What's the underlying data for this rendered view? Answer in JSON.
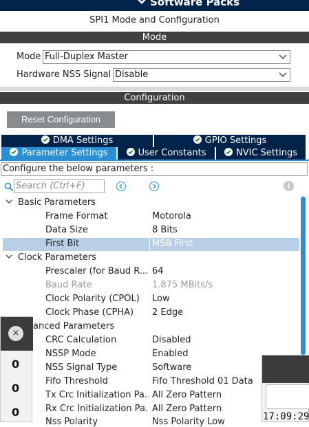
{
  "header": {
    "title": "Software Packs",
    "subtitle": "SPI1 Mode and Configuration"
  },
  "mode_section": {
    "title": "Mode",
    "mode_label": "Mode",
    "mode_value": "Full-Duplex Master",
    "nss_label": "Hardware NSS Signal",
    "nss_value": "Disable"
  },
  "config_section": {
    "title": "Configuration",
    "reset_button": "Reset Configuration"
  },
  "tabs": {
    "row1": [
      "DMA Settings",
      "GPIO Settings"
    ],
    "row2": [
      "Parameter Settings",
      "User Constants",
      "NVIC Settings"
    ],
    "active": "Parameter Settings"
  },
  "params": {
    "description": "Configure the below parameters :",
    "search_placeholder": "Search (Ctrl+F)",
    "info_icon": "i",
    "groups": [
      {
        "name": "Basic Parameters",
        "rows": [
          {
            "name": "Frame Format",
            "value": "Motorola"
          },
          {
            "name": "Data Size",
            "value": "8 Bits"
          },
          {
            "name": "First Bit",
            "value": "MSB First"
          }
        ]
      },
      {
        "name": "Clock Parameters",
        "rows": [
          {
            "name": "Prescaler (for Baud R...",
            "value": "64"
          },
          {
            "name": "Baud Rate",
            "value": "1.875 MBits/s"
          },
          {
            "name": "Clock Polarity (CPOL)",
            "value": "Low"
          },
          {
            "name": "Clock Phase (CPHA)",
            "value": "2 Edge"
          }
        ]
      },
      {
        "name": "anced Parameters",
        "rows": [
          {
            "name": "CRC Calculation",
            "value": "Disabled"
          },
          {
            "name": "NSSP Mode",
            "value": "Enabled"
          },
          {
            "name": "NSS Signal Type",
            "value": "Software"
          },
          {
            "name": "Fifo Threshold",
            "value": "Fifo Threshold 01 Data"
          },
          {
            "name": "Tx Crc Initialization Pa...",
            "value": "All Zero Pattern"
          },
          {
            "name": "Rx Crc Initialization Pa...",
            "value": "All Zero Pattern"
          },
          {
            "name": "Nss Polarity",
            "value": "Nss Polarity Low"
          }
        ]
      }
    ],
    "selected_row": "First Bit"
  },
  "overlay_left": {
    "close_icon": "×",
    "values": [
      "0",
      "0",
      "0"
    ]
  },
  "overlay_right": {
    "clock": "17:09:29"
  },
  "colors": {
    "dark_navy": "#03234b",
    "accent_blue": "#2a8fd3",
    "band_gray": "#404040",
    "selection": "#b9cfe8"
  }
}
